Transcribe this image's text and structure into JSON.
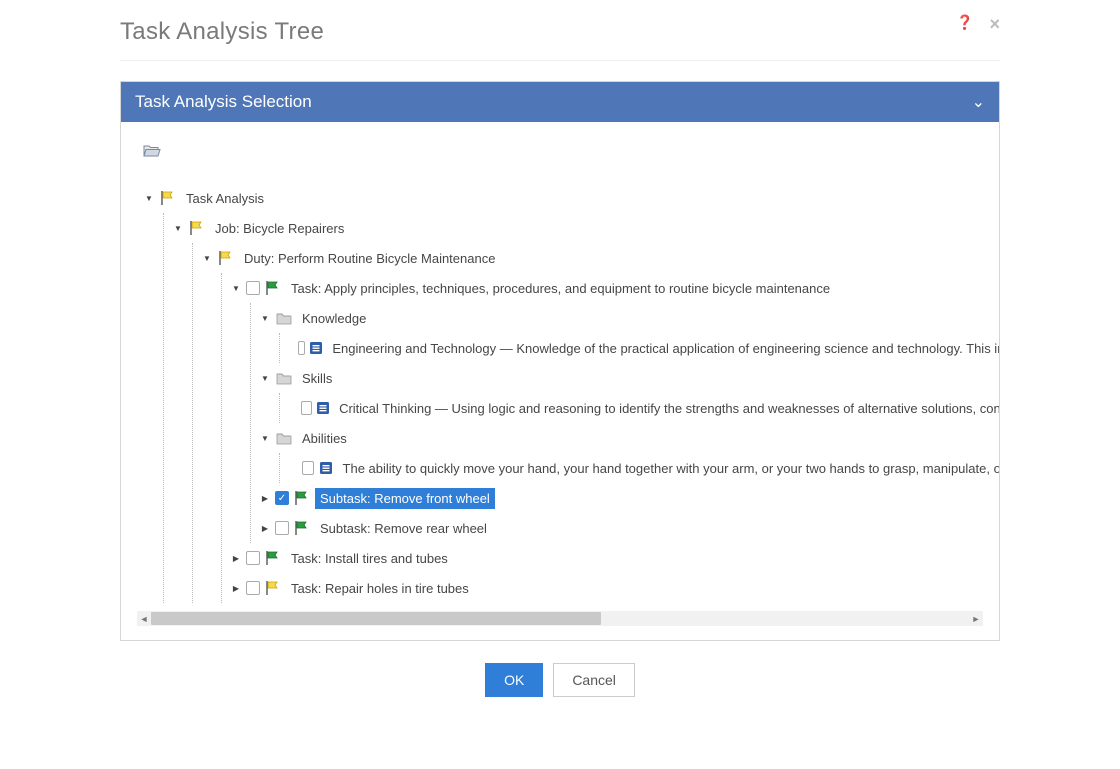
{
  "page": {
    "title": "Task Analysis Tree"
  },
  "panel": {
    "title": "Task Analysis Selection"
  },
  "tree": {
    "root": "Task Analysis",
    "job": "Job: Bicycle Repairers",
    "duty": "Duty: Perform Routine Bicycle Maintenance",
    "task1": "Task: Apply principles, techniques, procedures, and equipment to routine bicycle maintenance",
    "knowledge": "Knowledge",
    "knowledge_item": "Engineering and Technology — Knowledge of the practical application of engineering science and technology. This includes applying principles, techniques, procedures, and equipment to the design and production of various goods and services.",
    "skills": "Skills",
    "skills_item": "Critical Thinking — Using logic and reasoning to identify the strengths and weaknesses of alternative solutions, conclusions or approaches to problems.",
    "abilities": "Abilities",
    "abilities_item": "The ability to quickly move your hand, your hand together with your arm, or your two hands to grasp, manipulate, or assemble objects.",
    "subtask_front": "Subtask: Remove front wheel",
    "subtask_rear": "Subtask: Remove rear wheel",
    "task2": "Task: Install tires and tubes",
    "task3": "Task: Repair holes in tire tubes"
  },
  "buttons": {
    "ok": "OK",
    "cancel": "Cancel"
  }
}
